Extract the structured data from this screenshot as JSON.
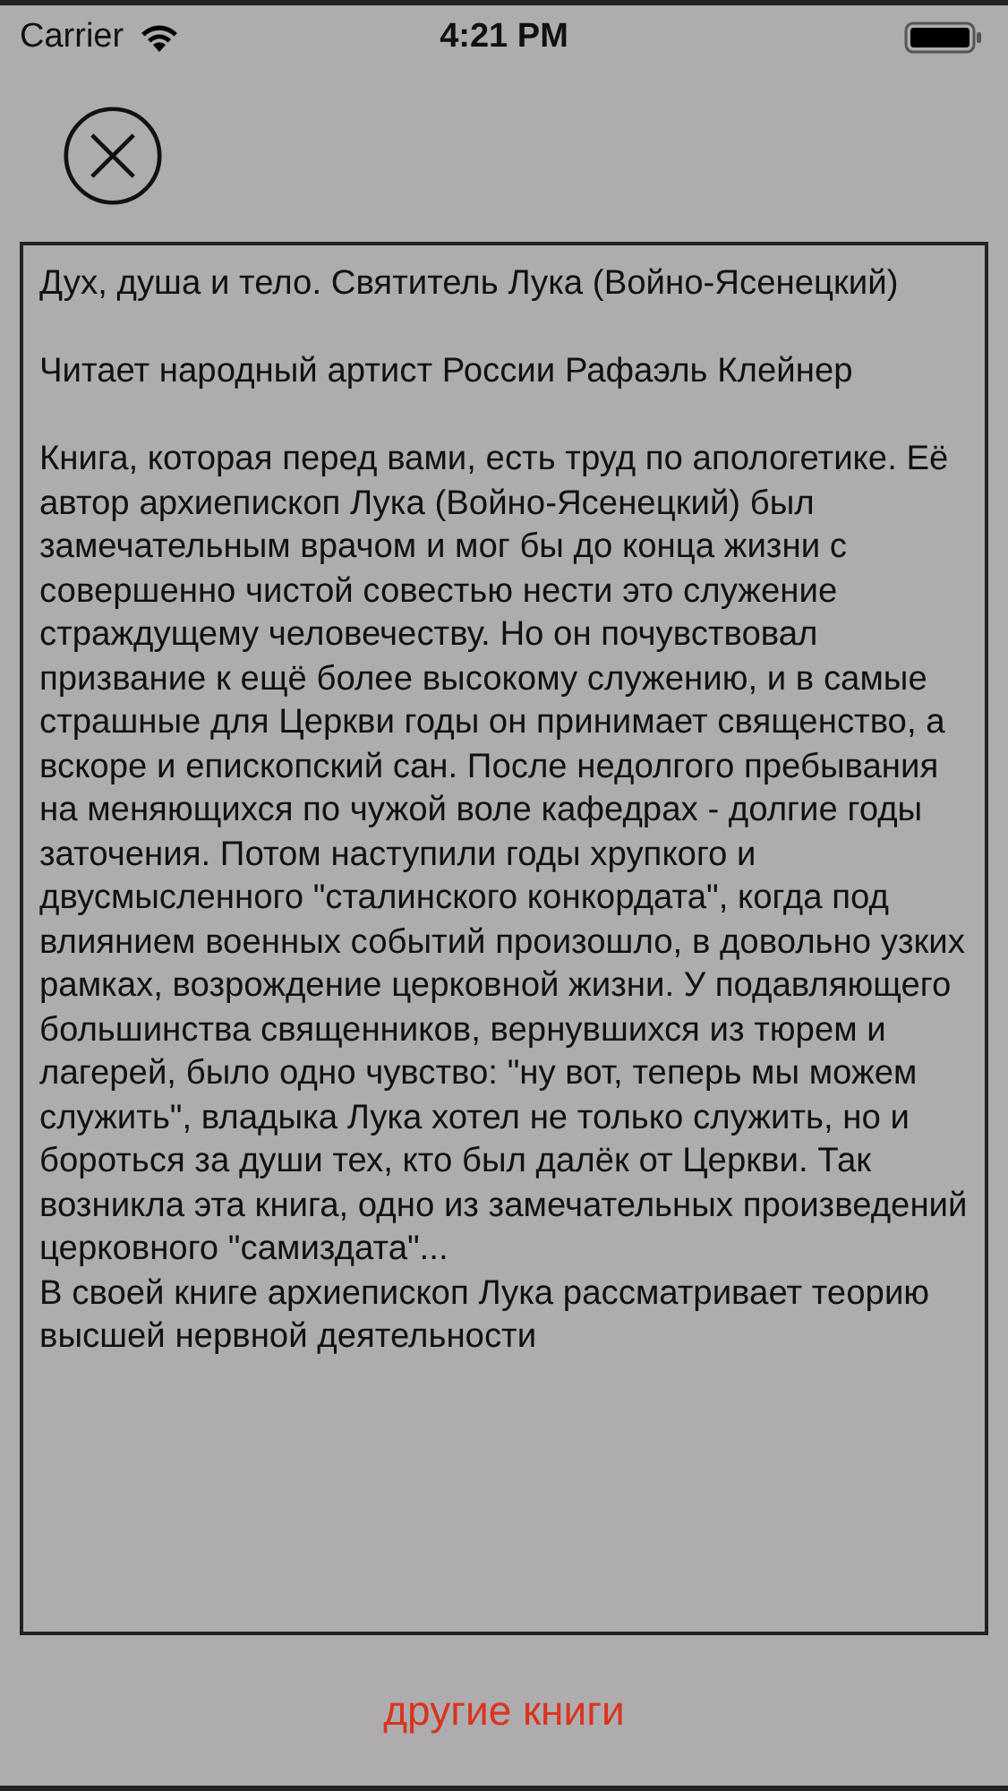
{
  "status_bar": {
    "carrier": "Carrier",
    "time": "4:21 PM"
  },
  "book": {
    "title": "Дух, душа и тело. Святитель Лука (Войно-Ясенецкий)",
    "reader": "Читает народный артист России Рафаэль Клейнер",
    "description": [
      "Книга, которая перед вами, есть труд по апологетике. Её автор архиепископ Лука (Войно-Ясенецкий) был замечательным врачом и мог бы до конца жизни с совершенно чистой совестью нести это служение страждущему человечеству. Но он почувствовал призвание к ещё более высокому служению, и в самые страшные для Церкви годы он принимает священство, а вскоре и епископский сан. После недолгого пребывания на меняющихся по чужой воле кафедрах - долгие годы заточения. Потом наступили годы хрупкого и двусмысленного \"сталинского конкордата\", когда под влиянием военных событий произошло, в довольно узких рамках, возрождение церковной жизни. У подавляющего большинства священников, вернувшихся из тюрем и лагерей, было одно чувство: \"ну вот, теперь мы можем служить\", владыка Лука хотел не только служить, но и бороться за души тех, кто был далёк от Церкви. Так возникла эта книга, одно из замечательных произведений церковного \"самиздата\"...",
      "В своей книге архиепископ Лука рассматривает теорию высшей нервной деятельности"
    ]
  },
  "other_books_button": "другие книги"
}
